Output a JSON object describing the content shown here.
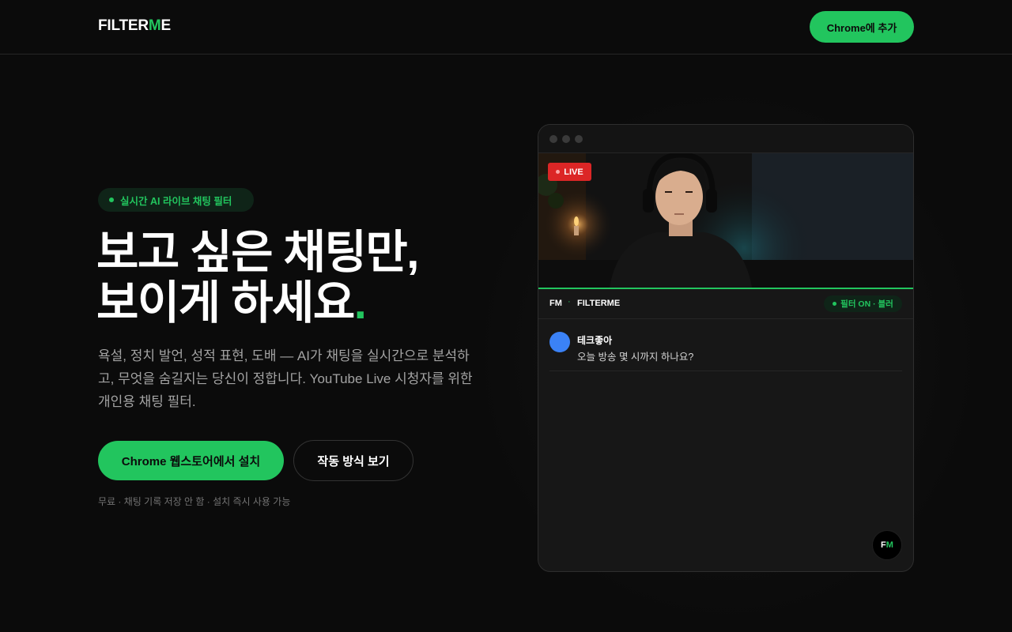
{
  "nav": {
    "logo_prefix": "FILTER",
    "logo_accent": "M",
    "logo_suffix": "E",
    "cta_label": "Chrome에 추가"
  },
  "hero": {
    "badge": "실시간 AI 라이브 채팅 필터",
    "headline_line1": "보고 싶은 채팅만,",
    "headline_line2": "보이게 하세요",
    "headline_accent": ".",
    "description": "욕설, 정치 발언, 성적 표현, 도배 — AI가 채팅을 실시간으로 분석하고, 무엇을 숨길지는 당신이 정합니다. YouTube Live 시청자를 위한 개인용 채팅 필터.",
    "primary_cta": "Chrome 웹스토어에서 설치",
    "secondary_cta": "작동 방식 보기",
    "note": "무료 · 채팅 기록 저장 안 함 · 설치 즉시 사용 가능"
  },
  "mock": {
    "live_label": "LIVE",
    "chat_brand": "FM",
    "chat_separator": "·",
    "chat_name": "FILTERME",
    "filter_status": "필터 ON · 블러",
    "messages": [
      {
        "user": "테크좋아",
        "text": "오늘 방송 몇 시까지 하나요?"
      }
    ],
    "fab_prefix": "F",
    "fab_accent": "M"
  },
  "colors": {
    "accent": "#22c55e",
    "background": "#0b0b0b",
    "live": "#dc2626",
    "avatar": "#3b82f6"
  }
}
